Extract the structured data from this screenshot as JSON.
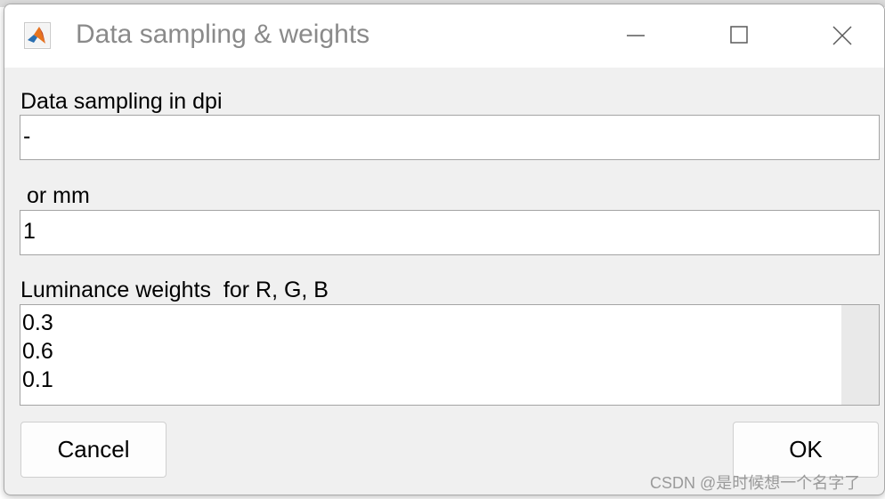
{
  "window": {
    "title": "Data sampling & weights",
    "app_icon": "matlab-icon",
    "controls": {
      "minimize_icon": "minimize-icon",
      "maximize_icon": "maximize-icon",
      "close_icon": "close-icon"
    }
  },
  "form": {
    "dpi": {
      "label": "Data sampling in dpi",
      "value": "-"
    },
    "mm": {
      "label": " or mm",
      "value": "1"
    },
    "weights": {
      "label": "Luminance weights  for R, G, B",
      "lines": [
        "0.3",
        "0.6",
        "0.1"
      ]
    }
  },
  "buttons": {
    "cancel_label": "Cancel",
    "ok_label": "OK"
  },
  "watermark": "CSDN @是时候想一个名字了",
  "colors": {
    "dialog_background": "#f0f0f0",
    "titlebar_background": "#ffffff",
    "title_text": "#8a8a8a"
  }
}
